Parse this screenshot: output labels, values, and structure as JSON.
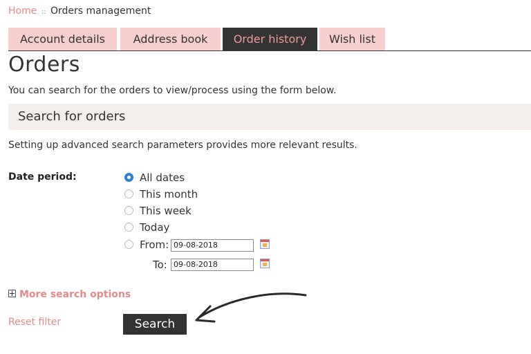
{
  "breadcrumb": {
    "home": "Home",
    "separator": "::",
    "current": "Orders management"
  },
  "tabs": [
    {
      "label": "Account details",
      "active": false
    },
    {
      "label": "Address book",
      "active": false
    },
    {
      "label": "Order history",
      "active": true
    },
    {
      "label": "Wish list",
      "active": false
    }
  ],
  "page": {
    "title": "Orders",
    "intro": "You can search for the orders to view/process using the form below."
  },
  "search": {
    "section_title": "Search for orders",
    "hint": "Setting up advanced search parameters provides more relevant results.",
    "date_period_label": "Date period:",
    "options": [
      {
        "label": "All dates",
        "checked": true
      },
      {
        "label": "This month",
        "checked": false
      },
      {
        "label": "This week",
        "checked": false
      },
      {
        "label": "Today",
        "checked": false
      },
      {
        "label": "From:",
        "checked": false
      }
    ],
    "from_value": "09-08-2018",
    "to_label": "To:",
    "to_value": "09-08-2018",
    "more_options": "More search options",
    "reset": "Reset filter",
    "submit": "Search"
  },
  "colors": {
    "accent": "#e58a8a",
    "tab_bg": "#f7cfcf",
    "dark": "#333333",
    "radio_checked": "#2f7fd8"
  }
}
